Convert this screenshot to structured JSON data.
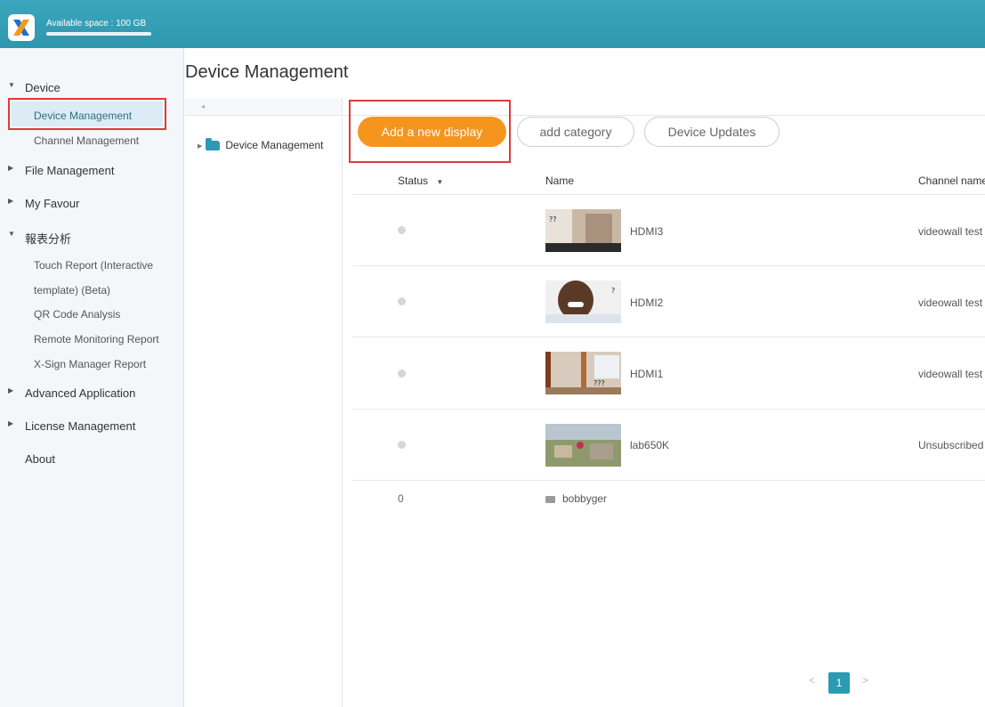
{
  "app": {
    "storage_text": "Available space : 100 GB",
    "storage_used_fraction": 1.0
  },
  "colors": {
    "accent": "#2b9ab3",
    "topbar": "#3aa6bd",
    "primary_button": "#f5951e",
    "highlight": "#e03a3a"
  },
  "sidebar": {
    "device": "Device",
    "device_management": "Device Management",
    "channel_management": "Channel Management",
    "file_management": "File Management",
    "my_favour": "My Favour",
    "report_analysis": "報表分析",
    "touch_report_line1": "Touch Report (Interactive",
    "touch_report_line2": "template) (Beta)",
    "qr_code_analysis": "QR Code Analysis",
    "remote_monitoring_report": "Remote Monitoring Report",
    "xsign_manager_report": "X-Sign Manager Report",
    "advanced_application": "Advanced Application",
    "license_management": "License Management",
    "about": "About"
  },
  "page": {
    "title": "Device Management"
  },
  "tree": {
    "root_label": "Device Management",
    "collapse_glyph": "◂"
  },
  "toolbar": {
    "add_display_label": "Add a new display",
    "add_category_label": "add category",
    "device_updates_label": "Device Updates"
  },
  "table": {
    "headers": {
      "status": "Status",
      "name": "Name",
      "channel": "Channel name"
    },
    "rows": [
      {
        "name": "HDMI3",
        "channel": "videowall test",
        "status": "offline"
      },
      {
        "name": "HDMI2",
        "channel": "videowall test",
        "status": "offline"
      },
      {
        "name": "HDMI1",
        "channel": "videowall test",
        "status": "offline"
      },
      {
        "name": "lab650K",
        "channel": "Unsubscribed",
        "status": "offline"
      }
    ],
    "folder_row": {
      "count": "0",
      "name": "bobbyger"
    }
  },
  "pagination": {
    "prev": "<",
    "current": "1",
    "next": ">"
  }
}
